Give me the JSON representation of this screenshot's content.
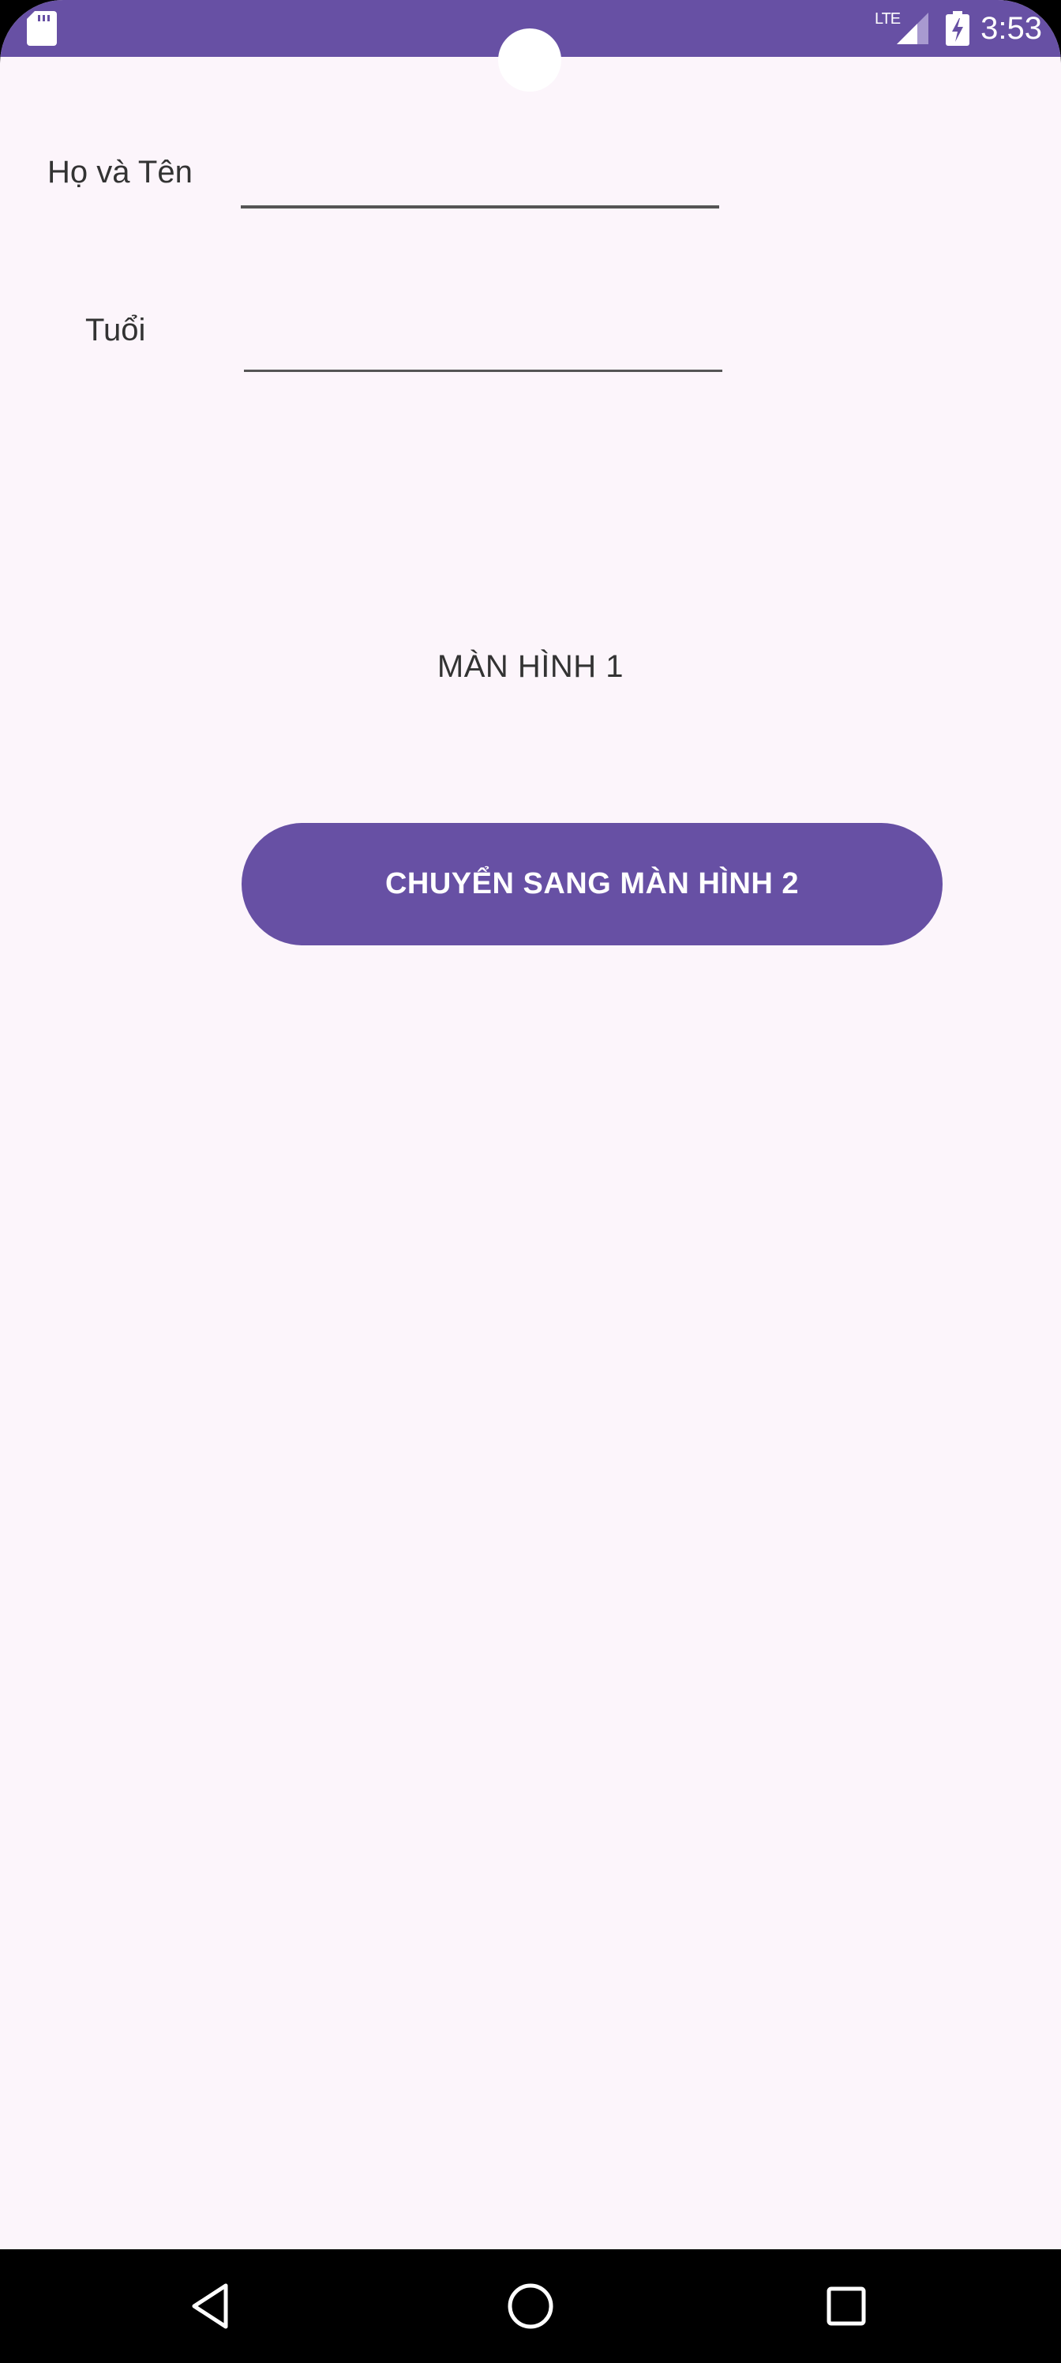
{
  "status_bar": {
    "time": "3:53",
    "network": "LTE",
    "icons": [
      "sd-card-icon",
      "signal-icon",
      "battery-charging-icon"
    ],
    "bg_color": "#6750a4"
  },
  "form": {
    "name_label": "Họ và Tên",
    "name_value": "",
    "age_label": "Tuổi",
    "age_value": ""
  },
  "screen_title": "MÀN HÌNH 1",
  "primary_button": {
    "label": "CHUYỂN SANG MÀN HÌNH 2",
    "color": "#6750a4"
  },
  "navigation": {
    "icons": [
      "back-icon",
      "home-icon",
      "recents-icon"
    ]
  },
  "colors": {
    "background": "#fcf5fb",
    "accent": "#6750a4",
    "text": "#333333"
  }
}
